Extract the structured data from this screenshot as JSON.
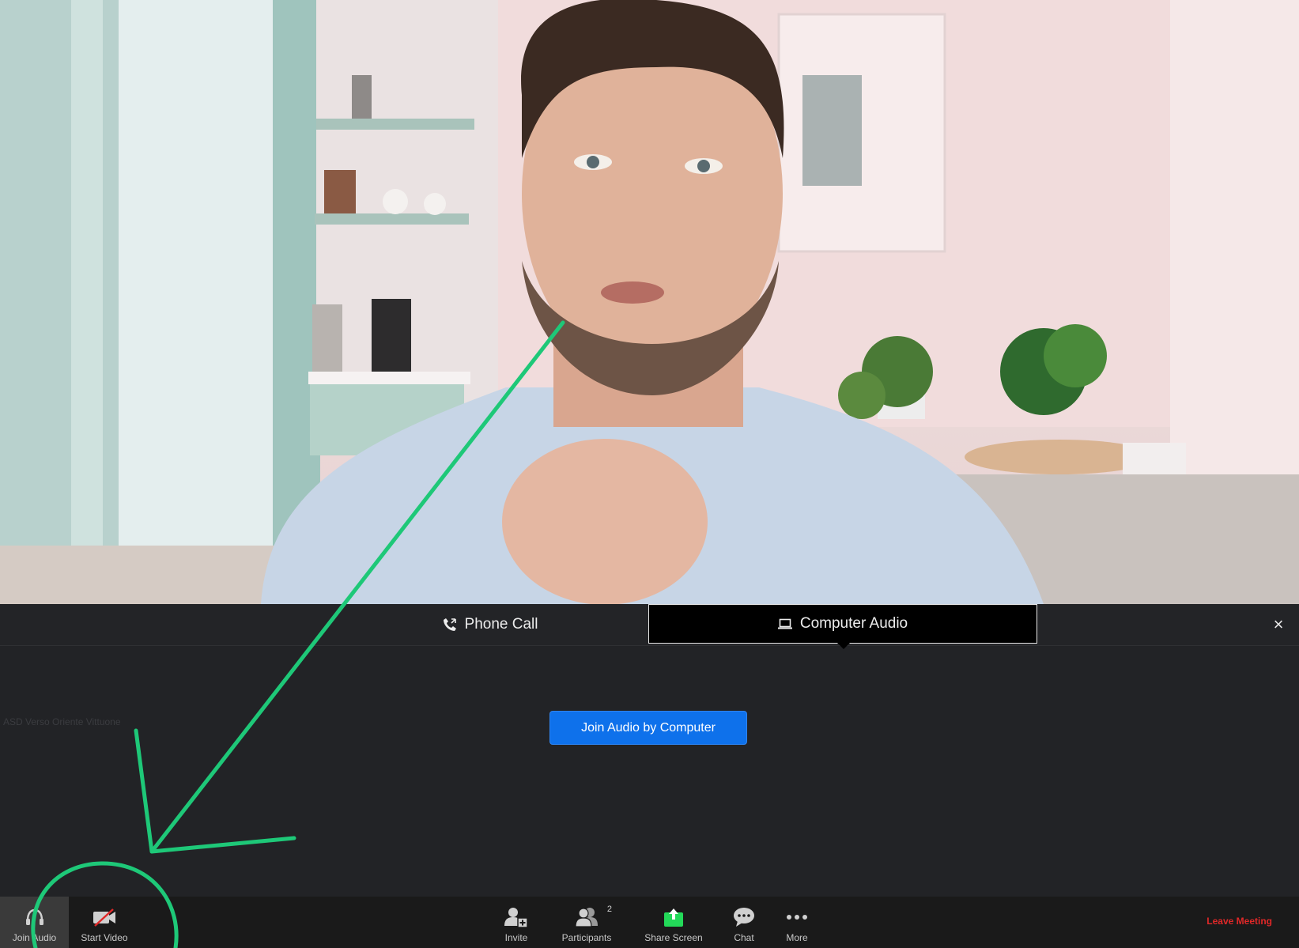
{
  "audio_dialog": {
    "tabs": [
      {
        "label": "Phone Call",
        "icon": "phone-call-icon",
        "selected": false
      },
      {
        "label": "Computer Audio",
        "icon": "laptop-icon",
        "selected": true
      }
    ],
    "close_icon": "close-icon",
    "join_button_label": "Join Audio by Computer"
  },
  "meeting_name": "ASD Verso Oriente Vittuone",
  "toolbar": {
    "join_audio_label": "Join Audio",
    "start_video_label": "Start Video",
    "invite_label": "Invite",
    "participants_label": "Participants",
    "participants_count": "2",
    "share_screen_label": "Share Screen",
    "chat_label": "Chat",
    "more_label": "More",
    "leave_label": "Leave Meeting"
  },
  "colors": {
    "join_button": "#0e71eb",
    "share_screen_icon": "#23d959",
    "leave_text": "#e02828",
    "annotation": "#1ec878"
  }
}
